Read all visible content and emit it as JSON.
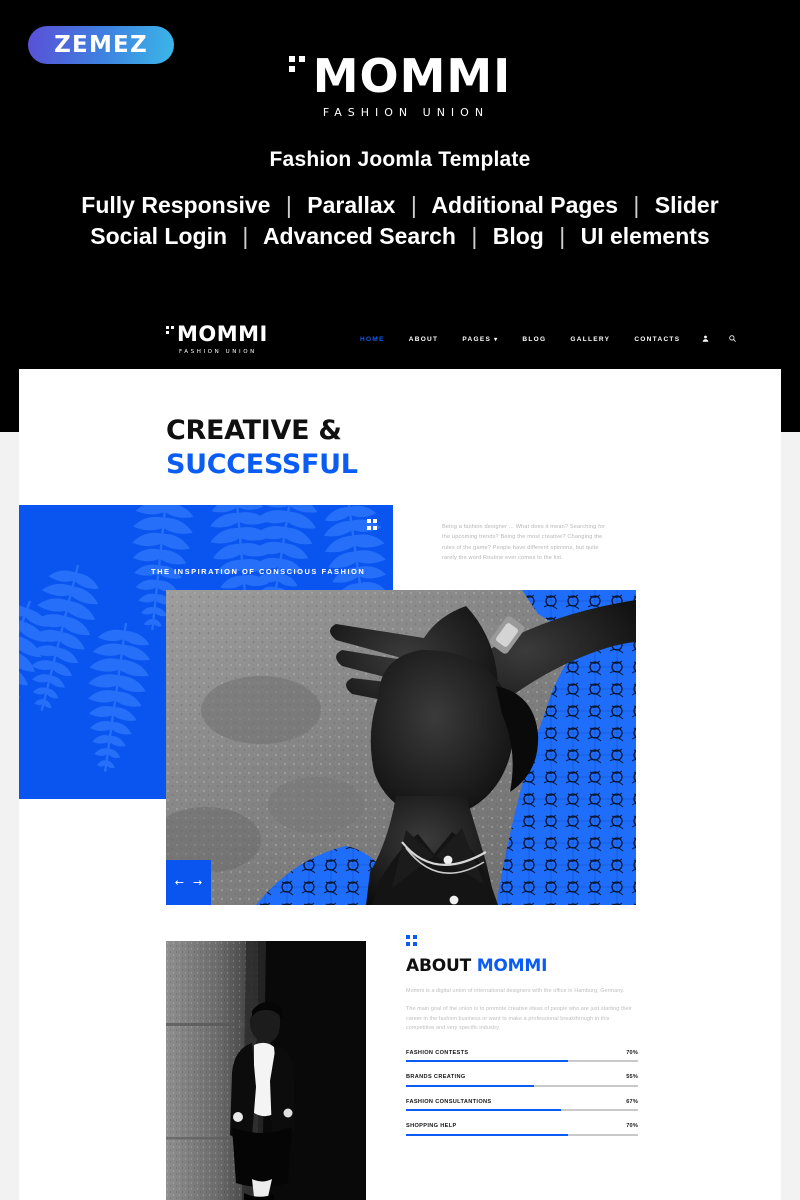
{
  "promo": {
    "badge": "ZEMEZ",
    "logo_word": "MOMMI",
    "logo_sub": "FASHION UNION",
    "tagline": "Fashion Joomla Template",
    "features_line1": [
      "Fully Responsive",
      "Parallax",
      "Additional Pages",
      "Slider"
    ],
    "features_line2": [
      "Social Login",
      "Advanced Search",
      "Blog",
      "UI elements"
    ],
    "separator": "|"
  },
  "site": {
    "nav": {
      "logo_word": "MOMMI",
      "logo_sub": "FASHION UNION",
      "items": [
        {
          "label": "HOME",
          "active": true
        },
        {
          "label": "ABOUT",
          "active": false
        },
        {
          "label": "PAGES",
          "active": false,
          "caret": "▾"
        },
        {
          "label": "BLOG",
          "active": false
        },
        {
          "label": "GALLERY",
          "active": false
        },
        {
          "label": "CONTACTS",
          "active": false
        }
      ],
      "user_icon": "὆4",
      "search_icon": "⌕"
    },
    "hero": {
      "heading_line1": "CREATIVE &",
      "heading_line2": "SUCCESSFUL",
      "banner_label": "THE INSPIRATION OF CONSCIOUS FASHION",
      "paragraph": "Being a fashion designer ... What does it mean? Searching for the upcoming trends? Being the most creative? Changing the rules of the game? People have different opinions, but quite rarely the word Routine ever comes to the list.",
      "prev_arrow": "←",
      "next_arrow": "→"
    },
    "about": {
      "title_black": "ABOUT",
      "title_blue": "MOMMI",
      "paragraph1": "Mommi is a digital union of international designers with the office in Hamburg, Germany.",
      "paragraph2": "The main goal of the union is to promote creative ideas of people who are just starting their career in the fashion business or want to make a professional breakthrough in this competitive and very specific industry.",
      "skills": [
        {
          "name": "FASHION CONTESTS",
          "value": "70%",
          "pct": 70
        },
        {
          "name": "BRANDS CREATING",
          "value": "55%",
          "pct": 55
        },
        {
          "name": "FASHION CONSULTANTIONS",
          "value": "67%",
          "pct": 67
        },
        {
          "name": "SHOPPING HELP",
          "value": "70%",
          "pct": 70
        }
      ]
    }
  },
  "colors": {
    "accent_blue": "#0a5cf5",
    "banner_blue": "#0a55f0",
    "background_black": "#000000",
    "panel_white": "#ffffff",
    "page_grey": "#f2f2f2"
  }
}
